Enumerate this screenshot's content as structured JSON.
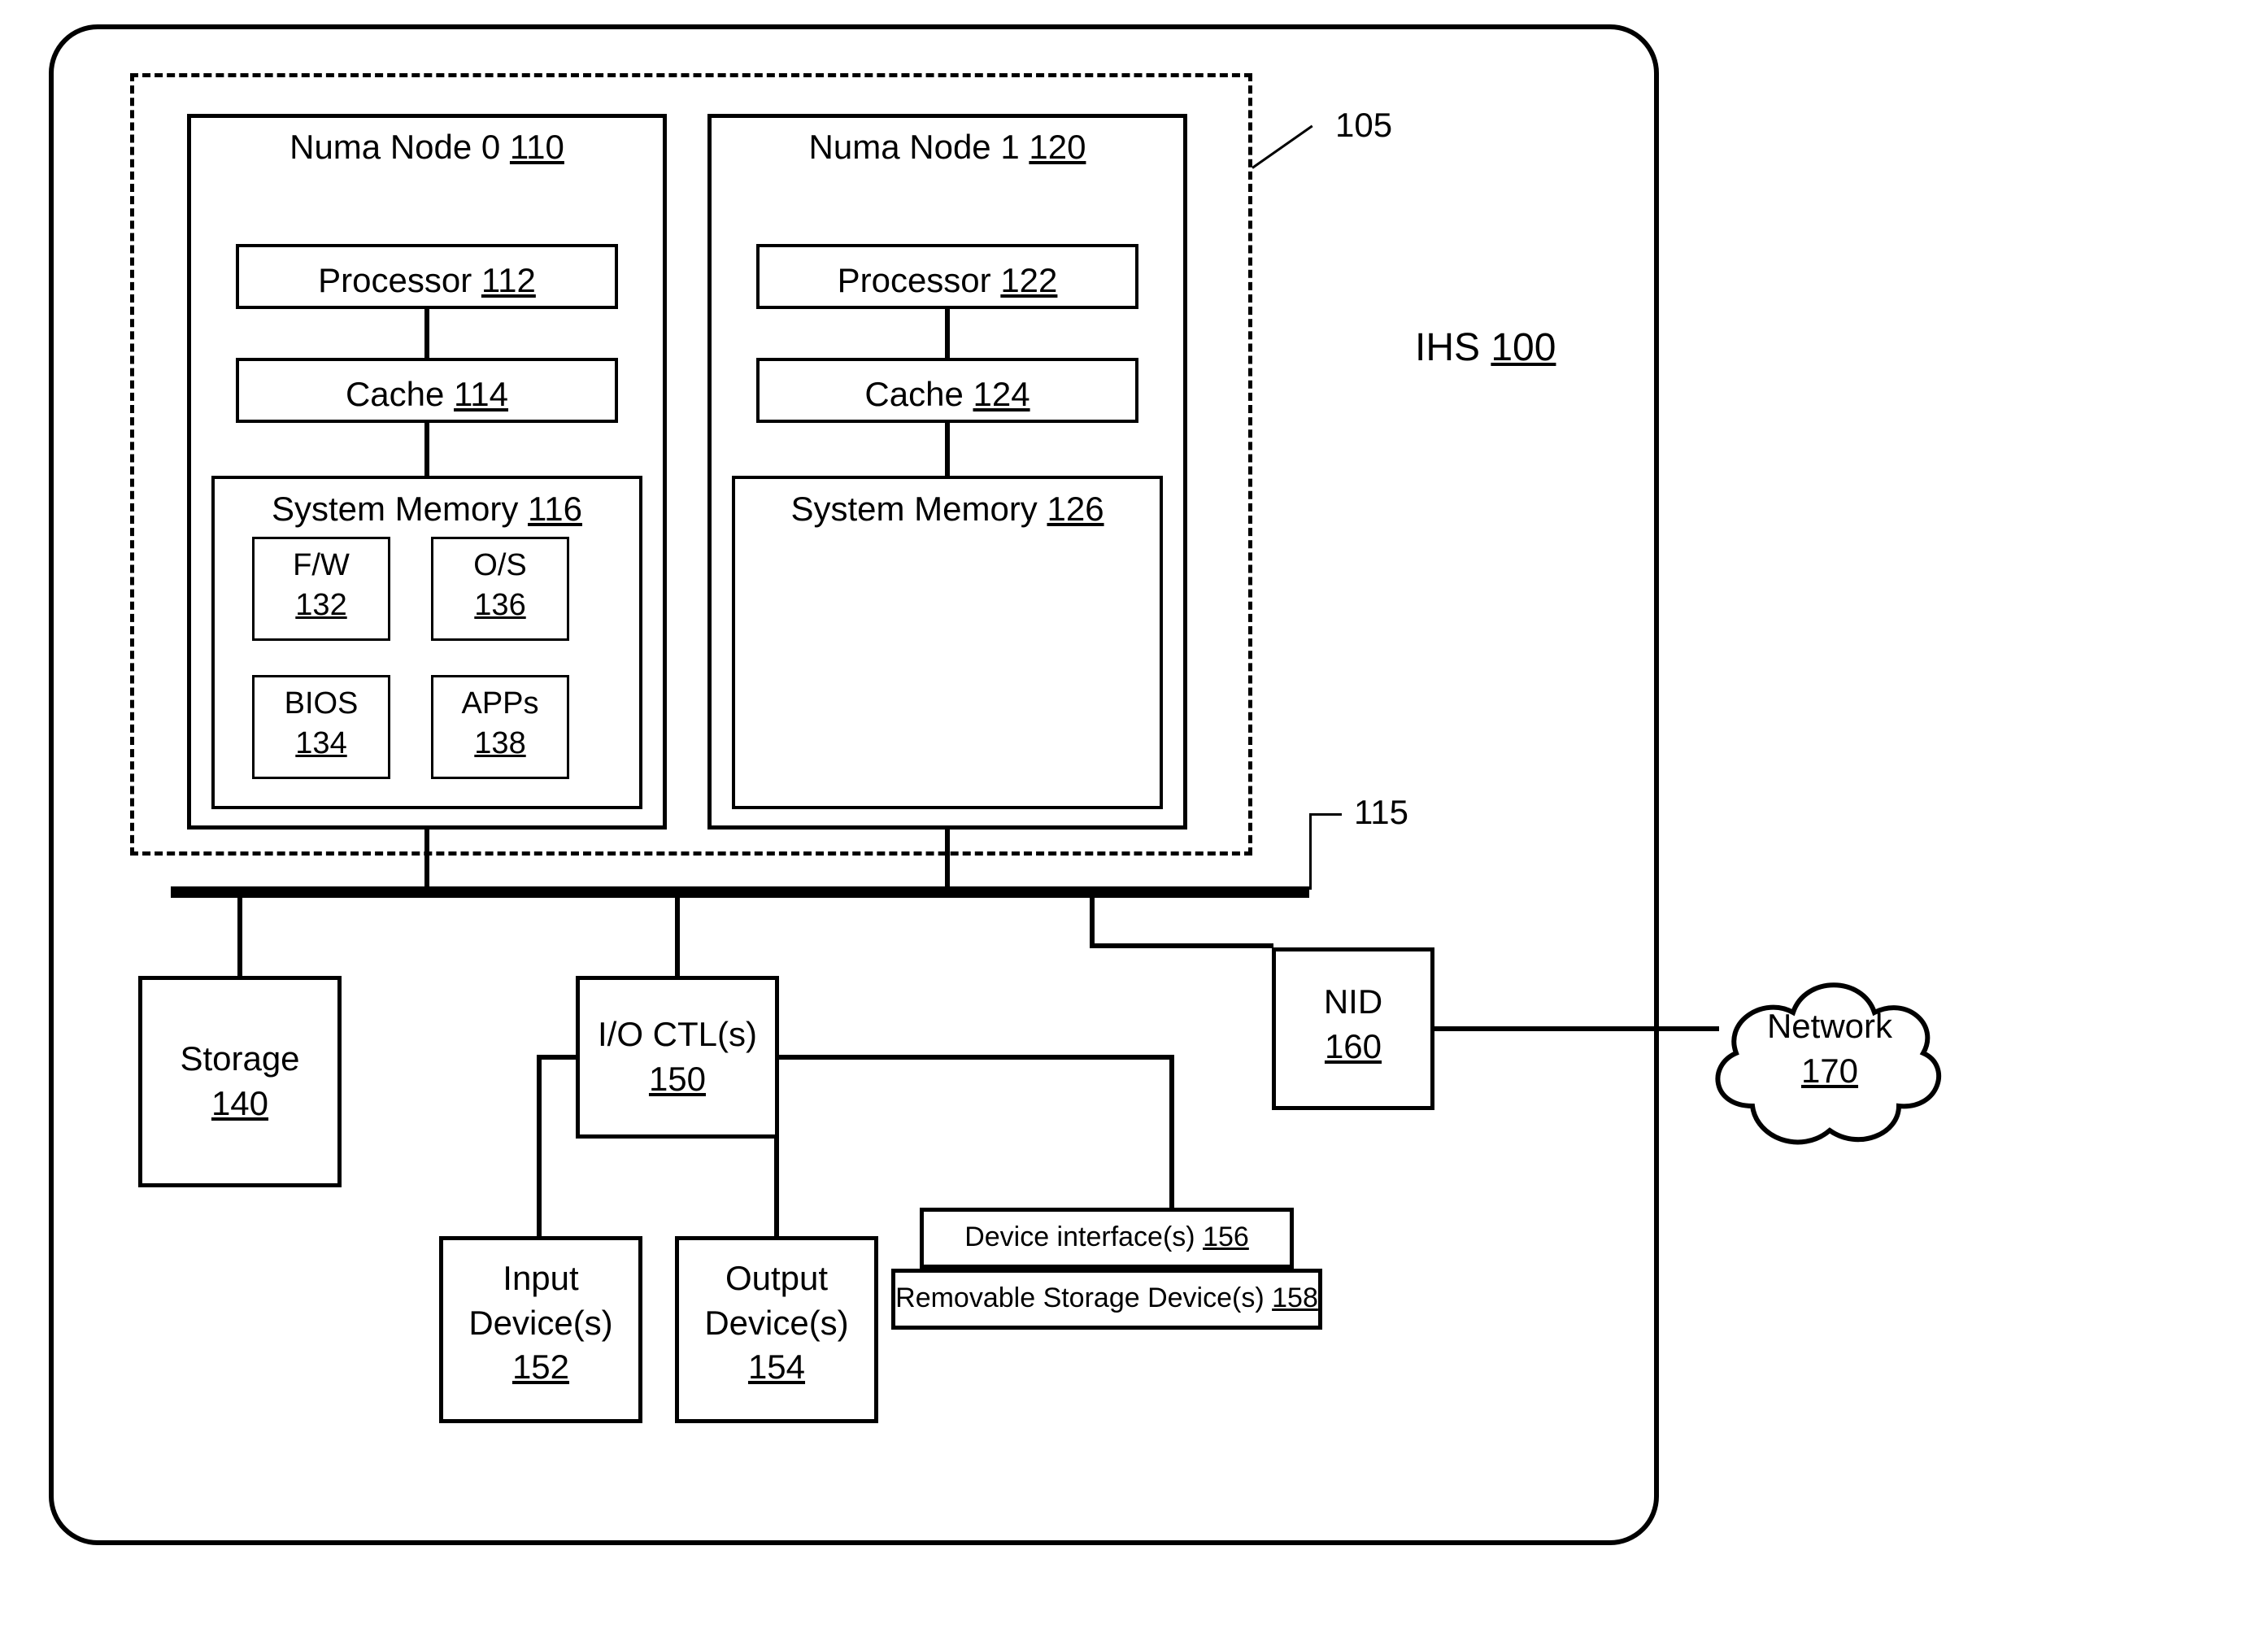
{
  "ihs": {
    "label": "IHS",
    "ref": "100"
  },
  "dashed_ref": "105",
  "bus_ref": "115",
  "node0": {
    "title": "Numa Node 0",
    "ref": "110",
    "processor": {
      "label": "Processor",
      "ref": "112"
    },
    "cache": {
      "label": "Cache",
      "ref": "114"
    },
    "sysmem": {
      "label": "System Memory",
      "ref": "116"
    },
    "fw": {
      "label": "F/W",
      "ref": "132"
    },
    "bios": {
      "label": "BIOS",
      "ref": "134"
    },
    "os": {
      "label": "O/S",
      "ref": "136"
    },
    "apps": {
      "label": "APPs",
      "ref": "138"
    }
  },
  "node1": {
    "title": "Numa Node 1",
    "ref": "120",
    "processor": {
      "label": "Processor",
      "ref": "122"
    },
    "cache": {
      "label": "Cache",
      "ref": "124"
    },
    "sysmem": {
      "label": "System Memory",
      "ref": "126"
    }
  },
  "storage": {
    "label": "Storage",
    "ref": "140"
  },
  "ioctl": {
    "label": "I/O CTL(s)",
    "ref": "150"
  },
  "input": {
    "label": "Input Device(s)",
    "ref": "152"
  },
  "output": {
    "label": "Output Device(s)",
    "ref": "154"
  },
  "devint": {
    "label": "Device interface(s)",
    "ref": "156"
  },
  "remstor": {
    "label": "Removable Storage Device(s)",
    "ref": "158"
  },
  "nid": {
    "label": "NID",
    "ref": "160"
  },
  "network": {
    "label": "Network",
    "ref": "170"
  }
}
